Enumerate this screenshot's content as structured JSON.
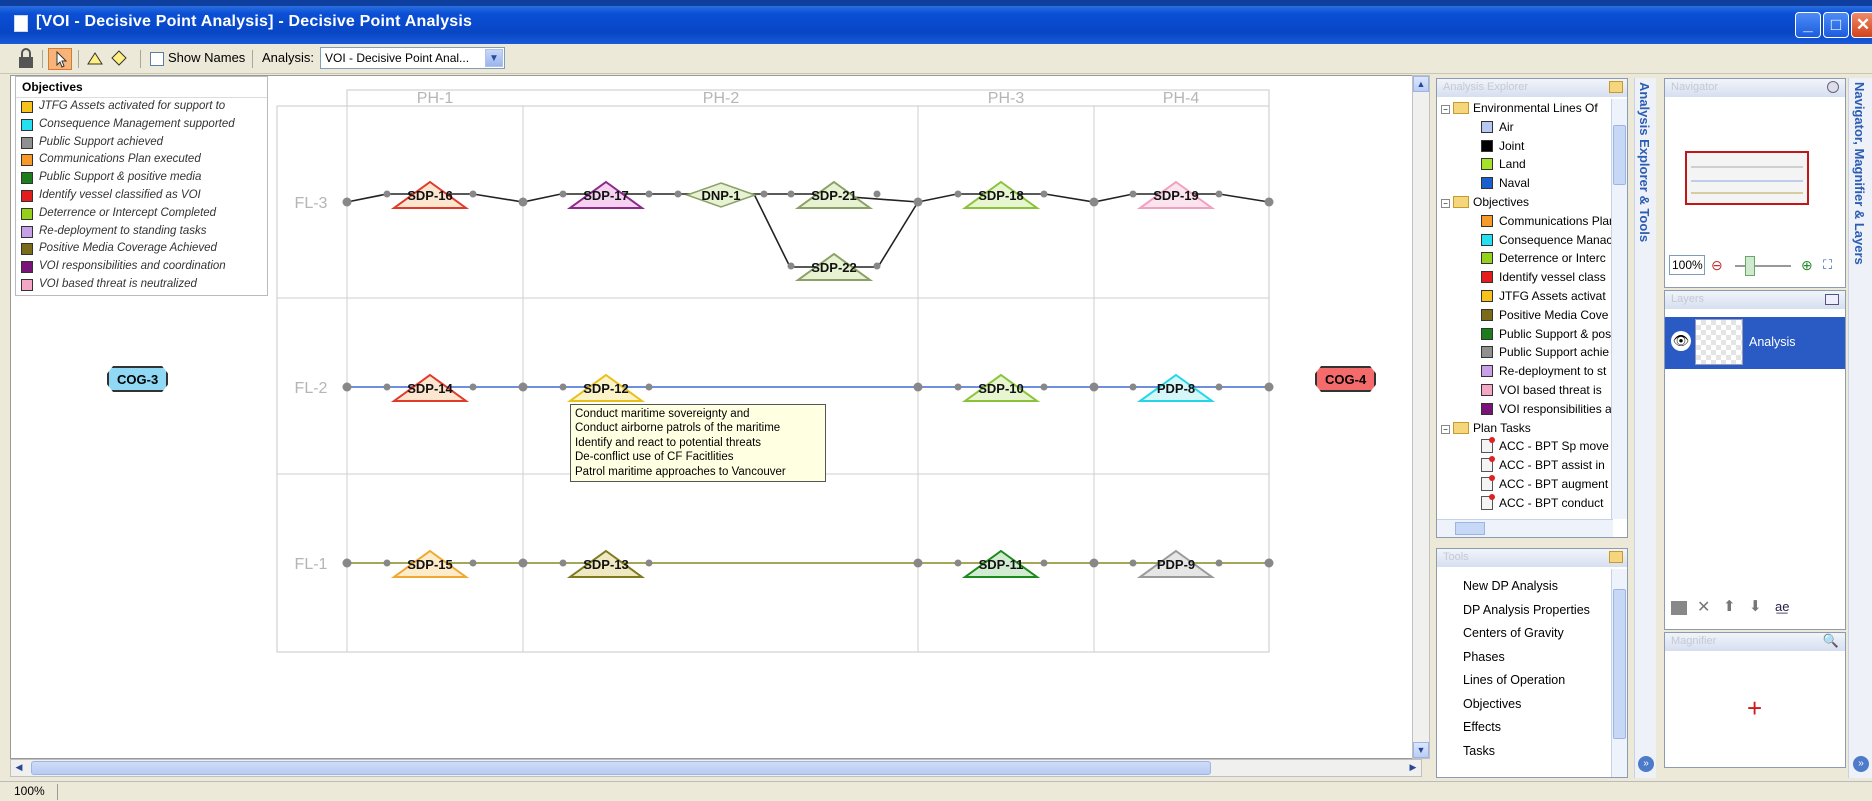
{
  "window": {
    "title": "[VOI - Decisive Point Analysis] - Decisive Point Analysis",
    "min": "_",
    "max": "□",
    "close": "✕"
  },
  "toolbar": {
    "show_names": "Show Names",
    "analysis_label": "Analysis:",
    "analysis_value": "VOI - Decisive Point Anal..."
  },
  "legend": {
    "title": "Objectives",
    "items": [
      {
        "label": "JTFG Assets activated for support to",
        "color": "#f7c21c"
      },
      {
        "label": "Consequence Management supported",
        "color": "#24e0f0"
      },
      {
        "label": "Public Support achieved",
        "color": "#909090"
      },
      {
        "label": "Communications Plan executed",
        "color": "#f79a2a"
      },
      {
        "label": "Public Support & positive media",
        "color": "#1d7d1d"
      },
      {
        "label": "Identify vessel classified as VOI",
        "color": "#e51c1c"
      },
      {
        "label": "Deterrence or Intercept Completed",
        "color": "#95d11a"
      },
      {
        "label": "Re-deployment to standing tasks",
        "color": "#c9a0e8"
      },
      {
        "label": "Positive Media Coverage Achieved",
        "color": "#7a6a1a"
      },
      {
        "label": "VOI responsibilities and coordination",
        "color": "#7a137a"
      },
      {
        "label": "VOI based threat is neutralized",
        "color": "#f4a6c6"
      }
    ]
  },
  "phases": [
    "PH-1",
    "PH-2",
    "PH-3",
    "PH-4"
  ],
  "lines": [
    "FL-3",
    "FL-2",
    "FL-1"
  ],
  "cogs": [
    {
      "label": "COG-3",
      "color": "#8fd9f5"
    },
    {
      "label": "COG-4",
      "color": "#f56b6b"
    }
  ],
  "nodes": [
    {
      "label": "SDP-16",
      "color": "#e03a2a",
      "fill": "#fde6cf"
    },
    {
      "label": "SDP-17",
      "color": "#8a2a8a",
      "fill": "#f4d2f0"
    },
    {
      "label": "DNP-1",
      "color": "#8aa066",
      "fill": "#e7f2d2"
    },
    {
      "label": "SDP-21",
      "color": "#8aa066",
      "fill": "#e7f2d2"
    },
    {
      "label": "SDP-22",
      "color": "#8aa066",
      "fill": "#e7f2d2"
    },
    {
      "label": "SDP-18",
      "color": "#8ac33a",
      "fill": "#e7f5d0"
    },
    {
      "label": "SDP-19",
      "color": "#f0a0c0",
      "fill": "#fbe4ee"
    },
    {
      "label": "SDP-14",
      "color": "#e03a2a",
      "fill": "#fde6cf"
    },
    {
      "label": "SDP-12",
      "color": "#e7c01a",
      "fill": "#fdf3c8"
    },
    {
      "label": "SDP-10",
      "color": "#8ac33a",
      "fill": "#e7f5d0"
    },
    {
      "label": "PDP-8",
      "color": "#24d6e6",
      "fill": "#d6f7fa"
    },
    {
      "label": "SDP-15",
      "color": "#f0a830",
      "fill": "#fdebc9"
    },
    {
      "label": "SDP-13",
      "color": "#7d7a20",
      "fill": "#efe8c0"
    },
    {
      "label": "SDP-11",
      "color": "#1d8a1d",
      "fill": "#d2ecd2"
    },
    {
      "label": "PDP-9",
      "color": "#9a9a9a",
      "fill": "#e6e6e6"
    }
  ],
  "tooltip": [
    "Conduct maritime sovereignty and",
    "Conduct airborne patrols of the maritime",
    "Identify and react to potential threats",
    "De-conflict use of CF Facitlities",
    "Patrol maritime approaches to Vancouver"
  ],
  "explorer": {
    "title": "Analysis Explorer",
    "tab": "Analysis Explorer & Tools",
    "folders": [
      "Environmental Lines Of",
      "Objectives",
      "Plan Tasks"
    ],
    "env_items": [
      {
        "label": "Air",
        "color": "#b8c8f2"
      },
      {
        "label": "Joint",
        "color": "#000000"
      },
      {
        "label": "Land",
        "color": "#a6e22a"
      },
      {
        "label": "Naval",
        "color": "#1a5fcf"
      }
    ],
    "objective_items": [
      {
        "label": "Communications Plan",
        "color": "#f79a2a"
      },
      {
        "label": "Consequence Manac",
        "color": "#24e0f0"
      },
      {
        "label": "Deterrence or Interc",
        "color": "#95d11a"
      },
      {
        "label": "Identify vessel class",
        "color": "#e51c1c"
      },
      {
        "label": "JTFG Assets activat",
        "color": "#f7c21c"
      },
      {
        "label": "Positive Media Cove",
        "color": "#7a6a1a"
      },
      {
        "label": "Public Support & pos",
        "color": "#1d7d1d"
      },
      {
        "label": "Public Support achie",
        "color": "#909090"
      },
      {
        "label": "Re-deployment to st",
        "color": "#c9a0e8"
      },
      {
        "label": "VOI based threat is",
        "color": "#f4a6c6"
      },
      {
        "label": "VOI responsibilities a",
        "color": "#7a137a"
      }
    ],
    "task_items": [
      "ACC - BPT Sp move",
      "ACC - BPT assist in",
      "ACC - BPT augment",
      "ACC - BPT conduct"
    ]
  },
  "tools": {
    "title": "Tools",
    "items": [
      "New DP Analysis",
      "DP Analysis Properties",
      "Centers of Gravity",
      "Phases",
      "Lines of Operation",
      "Objectives",
      "Effects",
      "Tasks"
    ]
  },
  "navigator": {
    "title": "Navigator",
    "tab": "Navigator, Magnifier & Layers",
    "zoom": "100%"
  },
  "layers": {
    "title": "Layers",
    "item": "Analysis"
  },
  "magnifier": {
    "title": "Magnifier"
  },
  "status": {
    "zoom": "100%"
  }
}
